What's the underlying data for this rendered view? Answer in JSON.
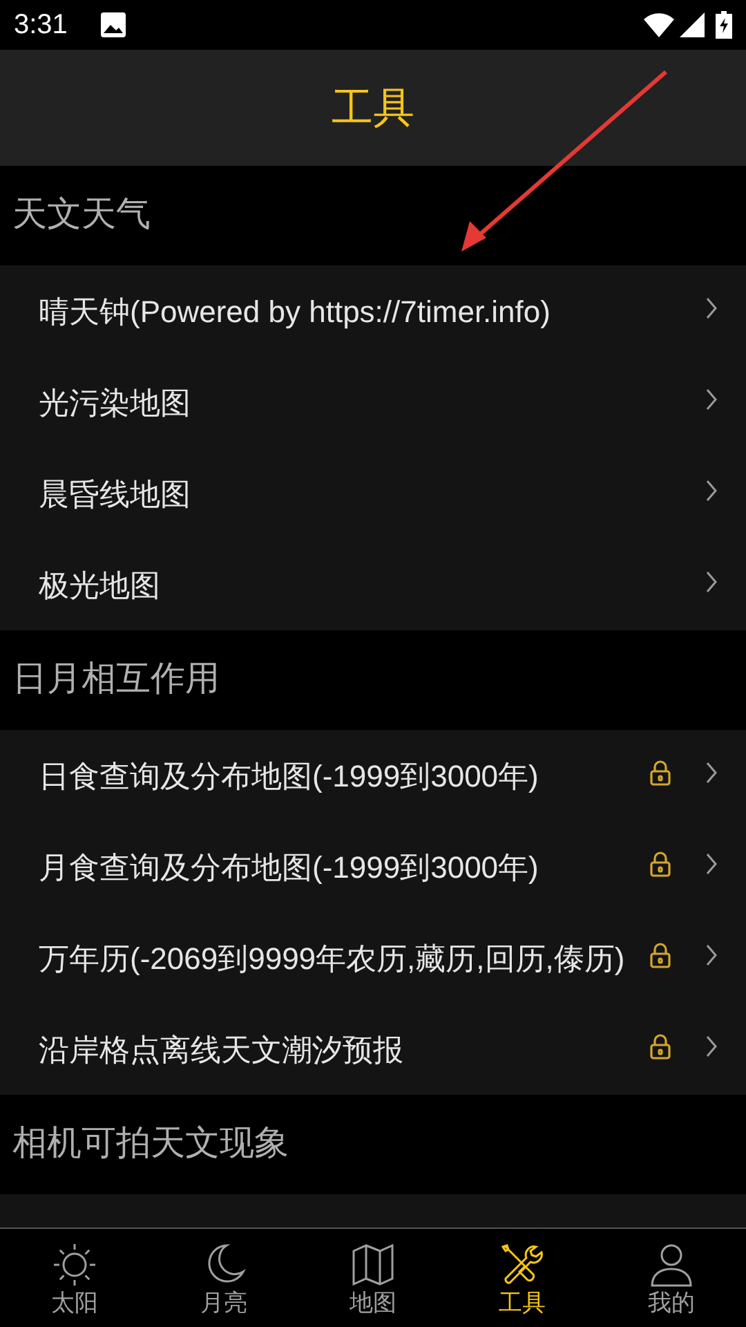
{
  "status_bar": {
    "time": "3:31"
  },
  "header": {
    "title": "工具"
  },
  "sections": [
    {
      "title": "天文天气",
      "items": [
        {
          "label": "晴天钟(Powered by https://7timer.info)",
          "locked": false
        },
        {
          "label": "光污染地图",
          "locked": false
        },
        {
          "label": "晨昏线地图",
          "locked": false
        },
        {
          "label": "极光地图",
          "locked": false
        }
      ]
    },
    {
      "title": "日月相互作用",
      "items": [
        {
          "label": "日食查询及分布地图(-1999到3000年)",
          "locked": true
        },
        {
          "label": "月食查询及分布地图(-1999到3000年)",
          "locked": true
        },
        {
          "label": "万年历(-2069到9999年农历,藏历,回历,傣历)",
          "locked": true
        },
        {
          "label": "沿岸格点离线天文潮汐预报",
          "locked": true
        }
      ]
    },
    {
      "title": "相机可拍天文现象"
    }
  ],
  "nav": [
    {
      "label": "太阳",
      "kind": "sun",
      "selected": false
    },
    {
      "label": "月亮",
      "kind": "moon",
      "selected": false
    },
    {
      "label": "地图",
      "kind": "map",
      "selected": false
    },
    {
      "label": "工具",
      "kind": "tools",
      "selected": true
    },
    {
      "label": "我的",
      "kind": "user",
      "selected": false
    }
  ]
}
